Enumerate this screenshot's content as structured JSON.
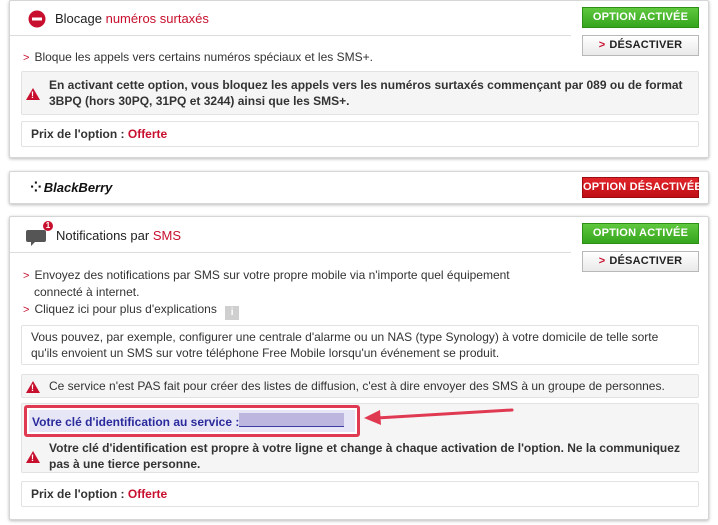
{
  "colors": {
    "accent_red": "#c8102e",
    "button_green": "#4bbb2f",
    "highlight_border": "#e03a52",
    "key_bg": "#e6e6f7",
    "key_text": "#2a2a9c"
  },
  "blocage": {
    "title_prefix": "Blocage ",
    "title_highlight": "numéros surtaxés",
    "icon": "no-entry-icon",
    "status_button": "OPTION ACTIVÉE",
    "deactivate_chevron": ">",
    "deactivate_label": "DÉSACTIVER",
    "bullet_chevron": ">",
    "bullet": "Bloque les appels vers certains numéros spéciaux et les SMS+.",
    "warning_line1": "En activant cette option, vous bloquez les appels vers les numéros surtaxés commençant par 089 ou de format",
    "warning_line2": "3BPQ (hors 30PQ, 31PQ et 3244) ainsi que les SMS+.",
    "price_label": "Prix de l'option : ",
    "price_value": "Offerte"
  },
  "blackberry": {
    "logo_text": "BlackBerry",
    "logo_mark": "⁘",
    "status_button": "OPTION DÉSACTIVÉE"
  },
  "sms": {
    "title_prefix": "Notifications par ",
    "title_highlight": "SMS",
    "icon": "sms-bubble-icon",
    "badge": "1",
    "status_button": "OPTION ACTIVÉE",
    "deactivate_chevron": ">",
    "deactivate_label": "DÉSACTIVER",
    "bullet_chevron": ">",
    "bullet1_line1": "Envoyez des notifications par SMS sur votre propre mobile via n'importe quel équipement",
    "bullet1_line2": "connecté à internet.",
    "bullet2": "Cliquez ici pour plus d'explications",
    "info_icon": "i",
    "info_line1": "Vous pouvez, par exemple, configurer une centrale d'alarme ou un NAS (type Synology) à votre domicile de telle sorte",
    "info_line2": "qu'ils envoient un SMS sur votre téléphone Free Mobile lorsqu'un événement se produit.",
    "warning": "Ce service n'est PAS fait pour créer des listes de diffusion, c'est à dire envoyer des SMS à un groupe de personnes.",
    "key_label": "Votre clé d'identification au service :",
    "key_warning_line1": "Votre clé d'identification est propre à votre ligne et change à chaque activation de l'option. Ne la communiquez",
    "key_warning_line2": "pas à une tierce personne.",
    "price_label": "Prix de l'option : ",
    "price_value": "Offerte"
  }
}
